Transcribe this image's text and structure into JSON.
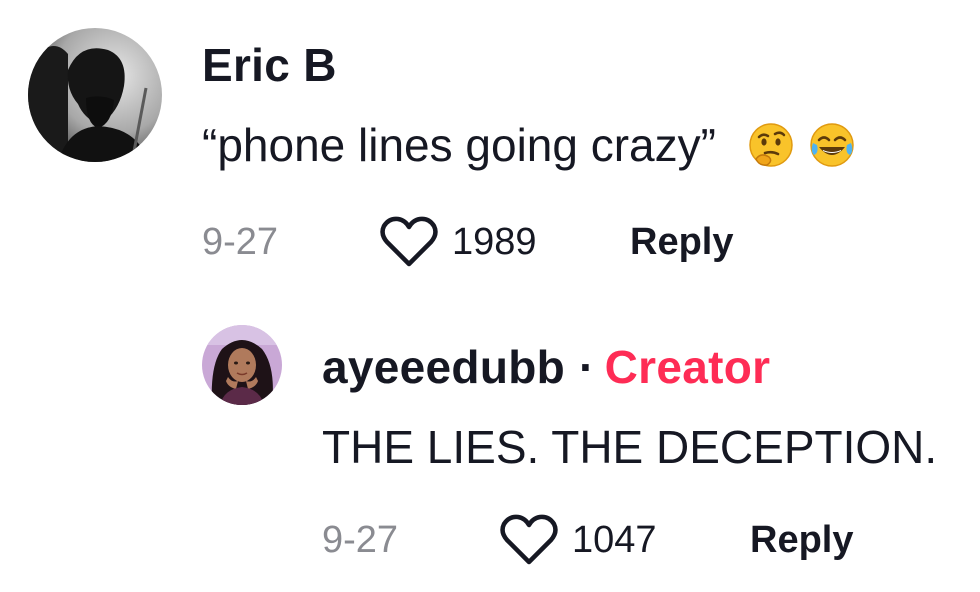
{
  "comments": [
    {
      "username": "Eric B",
      "text": "“phone lines going crazy”",
      "emojis": [
        "thinking-face",
        "tears-of-joy-face"
      ],
      "date": "9-27",
      "likes": "1989",
      "reply_label": "Reply"
    }
  ],
  "reply": {
    "username": "ayeeedubb",
    "separator": "·",
    "badge": "Creator",
    "text": "THE LIES. THE DECEPTION.",
    "date": "9-27",
    "likes": "1047",
    "reply_label": "Reply"
  },
  "colors": {
    "creator_badge": "#fe2c55",
    "date": "#8a8b91",
    "text": "#161823"
  }
}
